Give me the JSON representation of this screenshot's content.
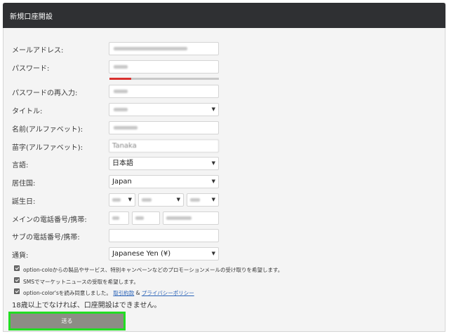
{
  "header": {
    "title": "新規口座開設"
  },
  "form": {
    "email": {
      "label": "メールアドレス:"
    },
    "password": {
      "label": "パスワード:",
      "strength": 0.2
    },
    "password_confirm": {
      "label": "パスワードの再入力:"
    },
    "title": {
      "label": "タイトル:"
    },
    "first_name": {
      "label": "名前(アルファベット):"
    },
    "last_name": {
      "label": "苗字(アルファベット):",
      "value": "Tanaka"
    },
    "language": {
      "label": "言語:",
      "value": "日本語"
    },
    "country": {
      "label": "居住国:",
      "value": "Japan"
    },
    "birthdate": {
      "label": "誕生日:"
    },
    "main_phone": {
      "label": "メインの電話番号/携帯:"
    },
    "sub_phone": {
      "label": "サブの電話番号/携帯:"
    },
    "currency": {
      "label": "通貨:",
      "value": "Japanese Yen (¥)"
    }
  },
  "checkboxes": [
    {
      "text": "option-coloからの製品やサービス、特別キャンペーンなどのプロモーションメールの受け取りを希望します。"
    },
    {
      "text": "SMSでマーケットニュースの受取を希望します。"
    },
    {
      "text": "option-color'sを読み同意しました。",
      "link1": "取引約款",
      "amp": "&",
      "link2": "プライバシーポリシー"
    }
  ],
  "notice": "18歳以上でなければ、口座開設はできません。",
  "submit_label": "送る",
  "colors": {
    "header_bg": "#2f3033",
    "submit_bg": "#8d8d85",
    "highlight": "#22dd22",
    "strength_bar": "#d9312f",
    "link": "#2a63b8"
  }
}
